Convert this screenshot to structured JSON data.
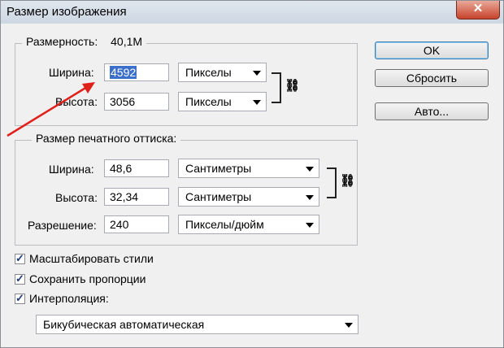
{
  "window": {
    "title": "Размер изображения",
    "close_glyph": "✕"
  },
  "pixel_dimensions": {
    "legend": "Размерность:",
    "size_value": "40,1М",
    "width_label": "Ширина:",
    "width_value": "4592",
    "width_unit": "Пикселы",
    "height_label": "Высота:",
    "height_value": "3056",
    "height_unit": "Пикселы"
  },
  "document_size": {
    "legend": "Размер печатного оттиска:",
    "width_label": "Ширина:",
    "width_value": "48,6",
    "width_unit": "Сантиметры",
    "height_label": "Высота:",
    "height_value": "32,34",
    "height_unit": "Сантиметры",
    "resolution_label": "Разрешение:",
    "resolution_value": "240",
    "resolution_unit": "Пикселы/дюйм"
  },
  "options": {
    "scale_styles": {
      "label": "Масштабировать стили",
      "checked": true
    },
    "constrain_proportions": {
      "label": "Сохранить пропорции",
      "checked": true
    },
    "resample": {
      "label": "Интерполяция:",
      "checked": true
    },
    "resample_method": "Бикубическая автоматическая"
  },
  "buttons": {
    "ok": "OK",
    "reset": "Сбросить",
    "auto": "Авто..."
  },
  "icons": {
    "link": "chain-link-icon",
    "checkmark": "✓"
  },
  "colors": {
    "annotation_arrow": "#e0201b",
    "selection": "#3b6fc9"
  }
}
